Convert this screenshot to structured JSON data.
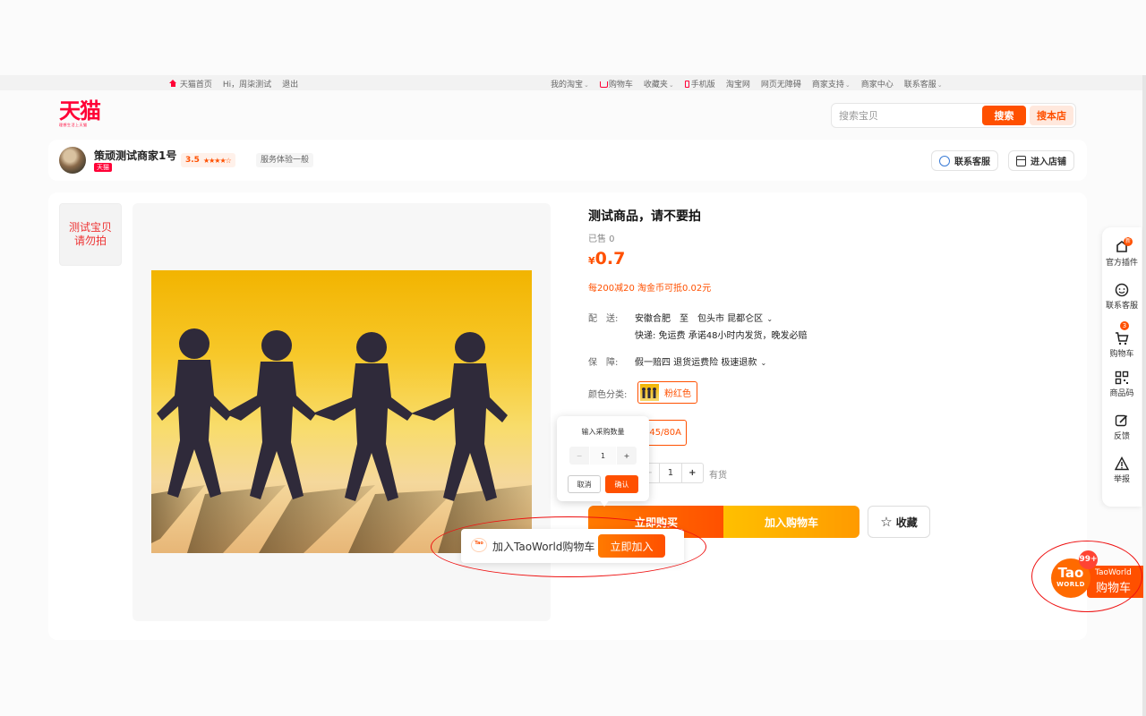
{
  "topbar": {
    "home": "天猫首页",
    "greeting": "Hi，周柒测试",
    "logout": "退出",
    "my_taobao": "我的淘宝",
    "cart": "购物车",
    "favorites": "收藏夹",
    "mobile": "手机版",
    "taobao": "淘宝网",
    "accessible": "网页无障碍",
    "merchant_support": "商家支持",
    "merchant_center": "商家中心",
    "contact_service": "联系客服"
  },
  "header": {
    "logo": "天猫",
    "slogan": "理想生活上天猫",
    "search_placeholder": "搜索宝贝",
    "search_button": "搜索",
    "search_store_button": "搜本店"
  },
  "shop": {
    "name": "策顽测试商家1号",
    "tag": "天猫",
    "rating": "3.5",
    "stars": "★★★★☆",
    "service_level": "服务体验一般",
    "contact_button": "联系客服",
    "enter_store_button": "进入店铺"
  },
  "product": {
    "thumb_text_line1": "测试宝贝",
    "thumb_text_line2": "请勿拍",
    "title": "测试商品，请不要拍",
    "sold": "已售 0",
    "currency": "¥",
    "price": "0.7",
    "promo": "每200减20 淘金币可抵0.02元",
    "delivery_label": "配　送:",
    "delivery_from": "安徽合肥　至　包头市 昆都仑区",
    "delivery_detail": "快递: 免运费  承诺48小时内发货，晚发必赔",
    "guarantee_label": "保　障:",
    "guarantee_value": "假一赔四  退货运费险  极速退款",
    "color_label": "颜色分类:",
    "color_value": "粉红色",
    "size_value": "45/80A",
    "quantity": "1",
    "stock": "有货",
    "buy_now": "立即购买",
    "add_to_cart": "加入购物车",
    "favorite": "收藏"
  },
  "qty_popup": {
    "title": "输入采购数量",
    "minus": "−",
    "value": "1",
    "plus": "+",
    "cancel": "取消",
    "confirm": "确认"
  },
  "taoworld_bar": {
    "logo": "Tao",
    "text": "加入TaoWorld购物车",
    "button": "立即加入"
  },
  "sidebar": {
    "items": [
      {
        "label": "官方插件",
        "badge": "新"
      },
      {
        "label": "联系客服"
      },
      {
        "label": "购物车",
        "badge": "3"
      },
      {
        "label": "商品码"
      },
      {
        "label": "反馈"
      },
      {
        "label": "举报"
      }
    ]
  },
  "taoworld_float": {
    "logo_top": "Tao",
    "logo_bottom": "WORLD",
    "badge": "99+",
    "label_top": "TaoWorld",
    "label_bottom": "购物车"
  },
  "colors": {
    "accent": "#ff5000",
    "tmall_red": "#ff0036",
    "annotation_red": "#e11111"
  }
}
